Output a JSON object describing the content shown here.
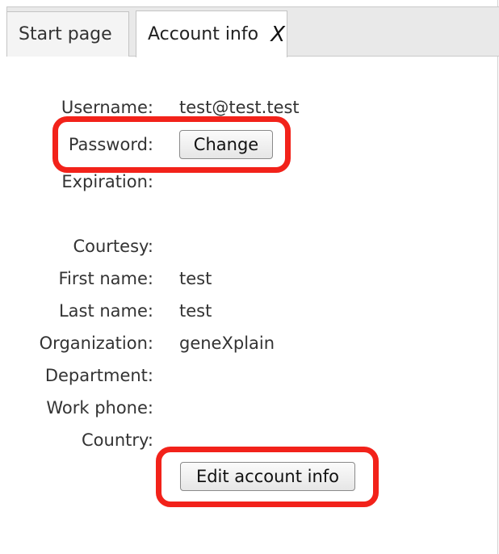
{
  "tabs": [
    {
      "label": "Start page",
      "active": false
    },
    {
      "label": "Account info",
      "active": true,
      "close_label": "X"
    }
  ],
  "account": {
    "username_label": "Username:",
    "username_value": "test@test.test",
    "password_label": "Password:",
    "change_button_label": "Change",
    "expiration_label": "Expiration:",
    "expiration_value": "",
    "courtesy_label": "Courtesy:",
    "courtesy_value": "",
    "first_name_label": "First name:",
    "first_name_value": "test",
    "last_name_label": "Last name:",
    "last_name_value": "test",
    "organization_label": "Organization:",
    "organization_value": "geneXplain",
    "department_label": "Department:",
    "department_value": "",
    "work_phone_label": "Work phone:",
    "work_phone_value": "",
    "country_label": "Country:",
    "country_value": "",
    "edit_button_label": "Edit account info"
  },
  "colors": {
    "highlight": "#f2221a",
    "tab_bar_bg": "#e9e9e9"
  }
}
